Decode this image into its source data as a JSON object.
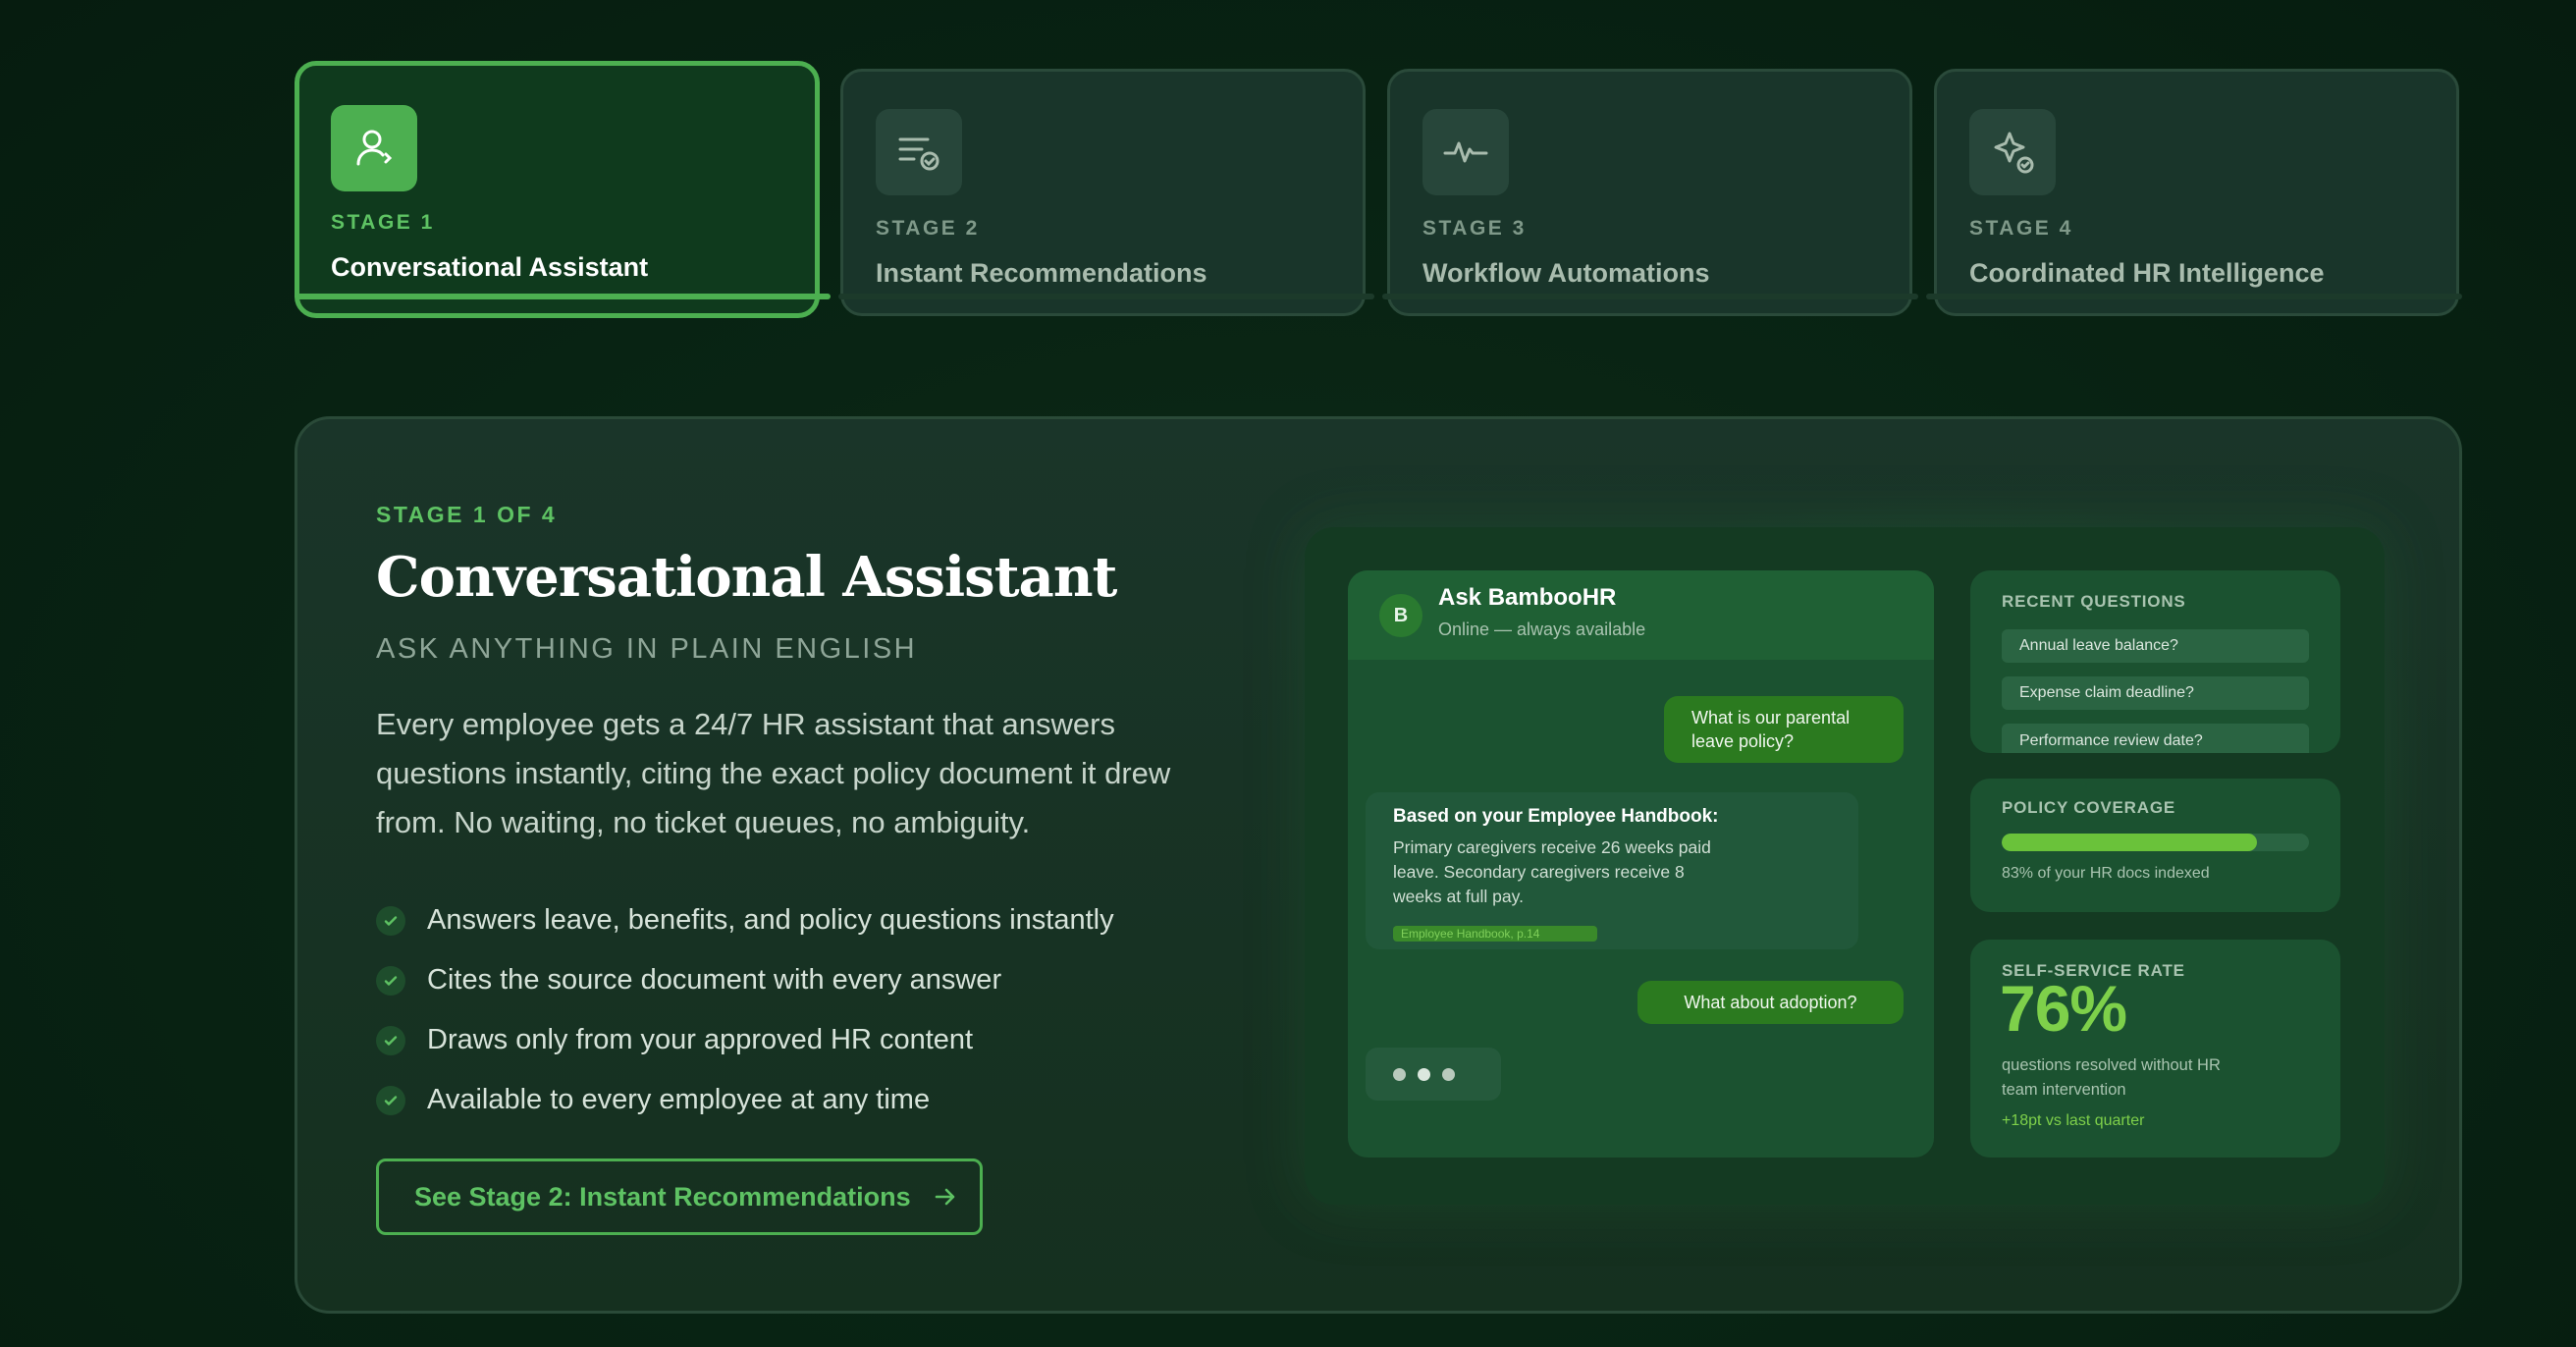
{
  "stages": [
    {
      "label": "STAGE 1",
      "title": "Conversational Assistant",
      "icon": "user-chat-icon",
      "active": true
    },
    {
      "label": "STAGE 2",
      "title": "Instant Recommendations",
      "icon": "list-check-icon",
      "active": false
    },
    {
      "label": "STAGE 3",
      "title": "Workflow Automations",
      "icon": "pulse-icon",
      "active": false
    },
    {
      "label": "STAGE 4",
      "title": "Coordinated HR Intelligence",
      "icon": "sparkle-check-icon",
      "active": false
    }
  ],
  "main": {
    "kicker": "STAGE 1 OF 4",
    "headline": "Conversational Assistant",
    "subhead": "ASK ANYTHING IN PLAIN ENGLISH",
    "description": "Every employee gets a 24/7 HR assistant that answers questions instantly, citing the exact policy document it drew from. No waiting, no ticket queues, no ambiguity.",
    "bullets": [
      "Answers leave, benefits, and policy questions instantly",
      "Cites the source document with every answer",
      "Draws only from your approved HR content",
      "Available to every employee at any time"
    ],
    "cta": "See Stage 2: Instant Recommendations"
  },
  "chat": {
    "avatar_letter": "B",
    "name": "Ask BambooHR",
    "status": "Online — always available",
    "user_message_1": "What is our parental leave policy?",
    "bot_title": "Based on your Employee Handbook:",
    "bot_body": "Primary caregivers receive 26 weeks paid leave. Secondary caregivers receive 8 weeks at full pay.",
    "bot_citation": "Employee Handbook, p.14",
    "user_message_2": "What about adoption?"
  },
  "recent_questions": {
    "title": "RECENT QUESTIONS",
    "items": [
      "Annual leave balance?",
      "Expense claim deadline?",
      "Performance review date?"
    ]
  },
  "policy_coverage": {
    "title": "POLICY COVERAGE",
    "percent": 83,
    "note": "83% of your HR docs indexed"
  },
  "self_service": {
    "title": "SELF-SERVICE RATE",
    "value": "76%",
    "note": "questions resolved without HR team intervention",
    "delta": "+18pt vs last quarter"
  },
  "colors": {
    "accent": "#4caf50",
    "accent_bright": "#7ed04a",
    "background": "#082313",
    "card": "#1a3529"
  }
}
